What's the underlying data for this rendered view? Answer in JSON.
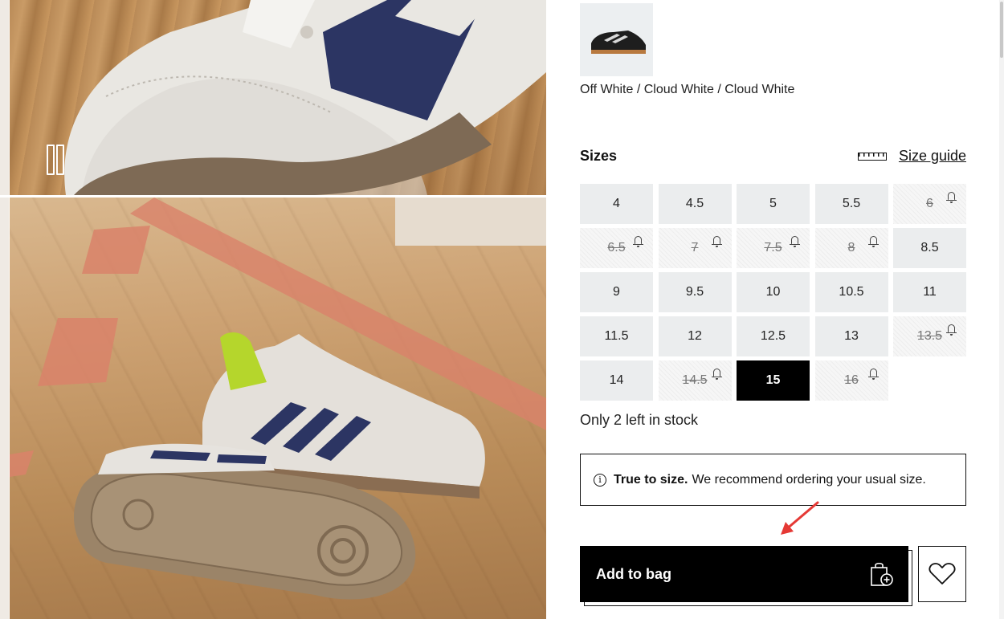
{
  "gallery": {
    "pause_icon": "pause-icon"
  },
  "product": {
    "color_name": "Off White / Cloud White / Cloud White"
  },
  "sizes": {
    "heading": "Sizes",
    "size_guide_label": "Size guide",
    "size_guide_icon": "ruler-icon",
    "options": [
      {
        "label": "4",
        "state": "available"
      },
      {
        "label": "4.5",
        "state": "available"
      },
      {
        "label": "5",
        "state": "available"
      },
      {
        "label": "5.5",
        "state": "available"
      },
      {
        "label": "6",
        "state": "sold-out"
      },
      {
        "label": "6.5",
        "state": "sold-out"
      },
      {
        "label": "7",
        "state": "sold-out"
      },
      {
        "label": "7.5",
        "state": "sold-out"
      },
      {
        "label": "8",
        "state": "sold-out"
      },
      {
        "label": "8.5",
        "state": "available"
      },
      {
        "label": "9",
        "state": "available"
      },
      {
        "label": "9.5",
        "state": "available"
      },
      {
        "label": "10",
        "state": "available"
      },
      {
        "label": "10.5",
        "state": "available"
      },
      {
        "label": "11",
        "state": "available"
      },
      {
        "label": "11.5",
        "state": "available"
      },
      {
        "label": "12",
        "state": "available"
      },
      {
        "label": "12.5",
        "state": "available"
      },
      {
        "label": "13",
        "state": "available"
      },
      {
        "label": "13.5",
        "state": "sold-out"
      },
      {
        "label": "14",
        "state": "available"
      },
      {
        "label": "14.5",
        "state": "sold-out"
      },
      {
        "label": "15",
        "state": "selected"
      },
      {
        "label": "16",
        "state": "sold-out"
      }
    ],
    "stock_message": "Only 2 left in stock"
  },
  "fit": {
    "bold": "True to size.",
    "text": "We recommend ordering your usual size.",
    "icon": "info-icon"
  },
  "actions": {
    "add_to_bag_label": "Add to bag",
    "bag_icon": "shopping-bag-plus-icon",
    "wishlist_icon": "heart-icon"
  },
  "colors": {
    "primary": "#000000",
    "tile_bg": "#ebedee",
    "annotation_arrow": "#e53935"
  }
}
